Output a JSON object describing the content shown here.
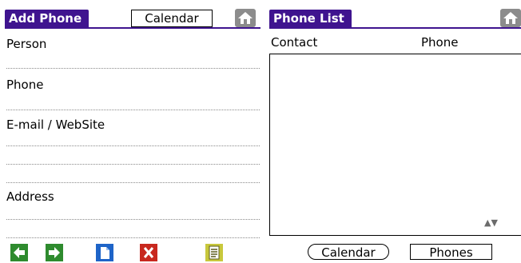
{
  "add_phone": {
    "title": "Add Phone",
    "calendar_label": "Calendar",
    "home_icon": "home-icon",
    "fields": [
      {
        "label": "Person",
        "lines": 1
      },
      {
        "label": "Phone",
        "lines": 1
      },
      {
        "label": "E-mail / WebSite",
        "lines": 3
      },
      {
        "label": "Address",
        "lines": 2
      }
    ],
    "toolbar_icons": [
      "arrow-left-icon",
      "arrow-right-icon",
      "new-page-icon",
      "delete-x-icon",
      "notes-icon"
    ]
  },
  "phone_list": {
    "title": "Phone List",
    "home_icon": "home-icon",
    "columns": [
      "Contact",
      "Phone"
    ],
    "scroll_icons": [
      "scroll-up-icon",
      "scroll-down-icon"
    ],
    "calendar_button": "Calendar",
    "phones_button": "Phones"
  },
  "colors": {
    "title_bar": "#3f148f",
    "home_button": "#8c8c8c",
    "arrow_green": "#2e8b2e",
    "doc_blue": "#1e64c8",
    "delete_red": "#c8281e",
    "notes_yellow": "#c8c83c"
  }
}
